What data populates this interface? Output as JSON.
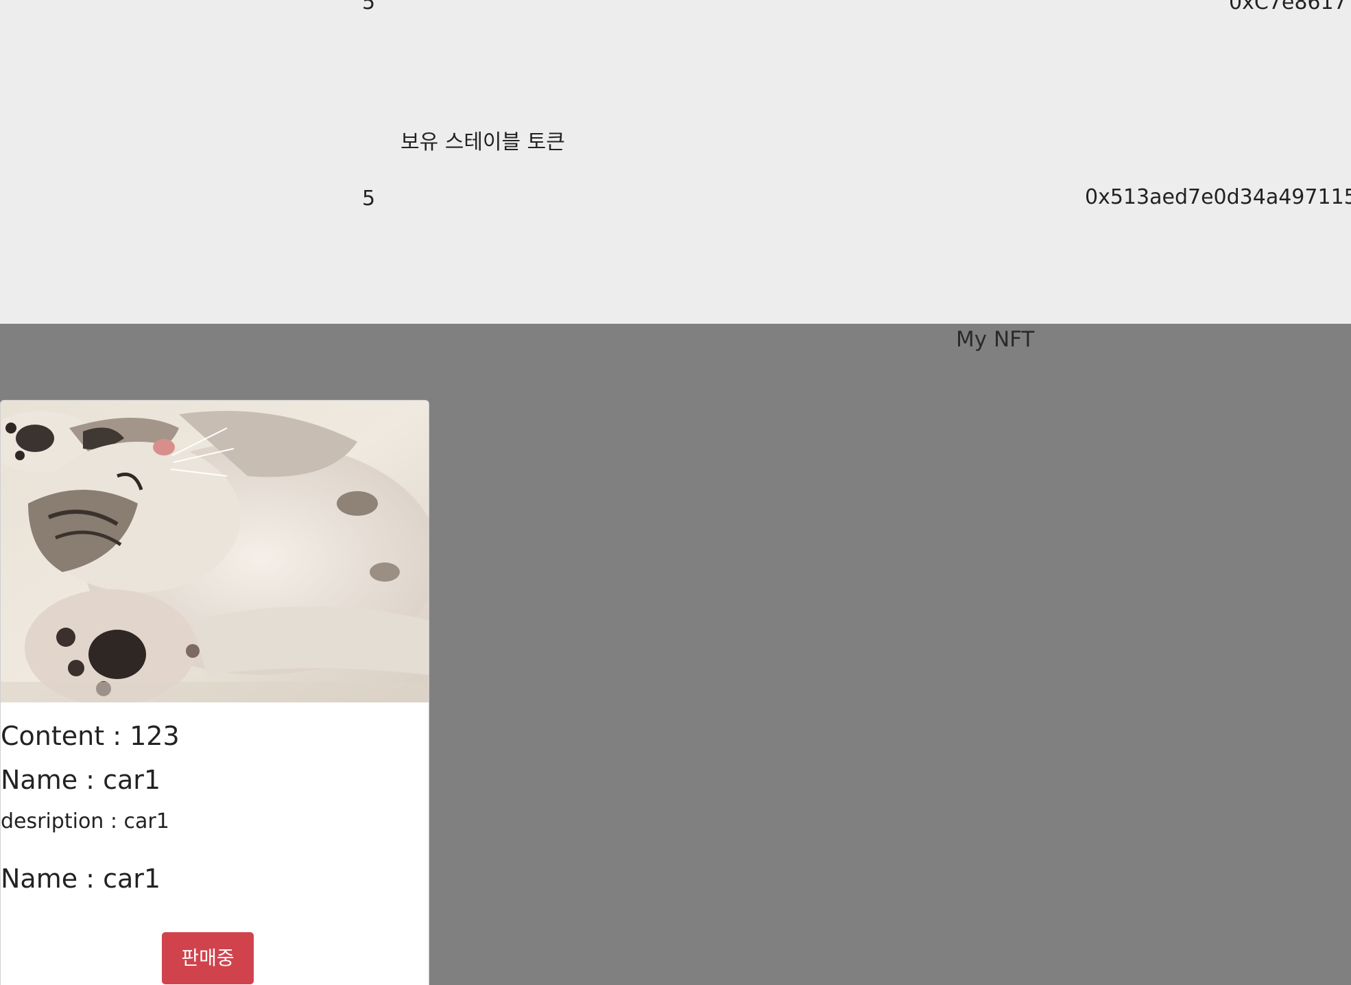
{
  "balances": {
    "row1_amount": "5",
    "row1_address": "0xC7e8617",
    "stable_token_label": "보유 스테이블 토큰",
    "row2_amount": "5",
    "row2_address": "0x513aed7e0d34a497115"
  },
  "nft_section": {
    "title": "My NFT",
    "cards": [
      {
        "image_icon": "kitten-photo",
        "content": "Content : 123",
        "name": "Name : car1",
        "description": "desription : car1",
        "name_repeat": "Name : car1",
        "status_button": "판매중"
      }
    ]
  },
  "colors": {
    "top_background": "#ededed",
    "section_background": "#808080",
    "card_background": "#ffffff",
    "button_red": "#d0434c"
  }
}
